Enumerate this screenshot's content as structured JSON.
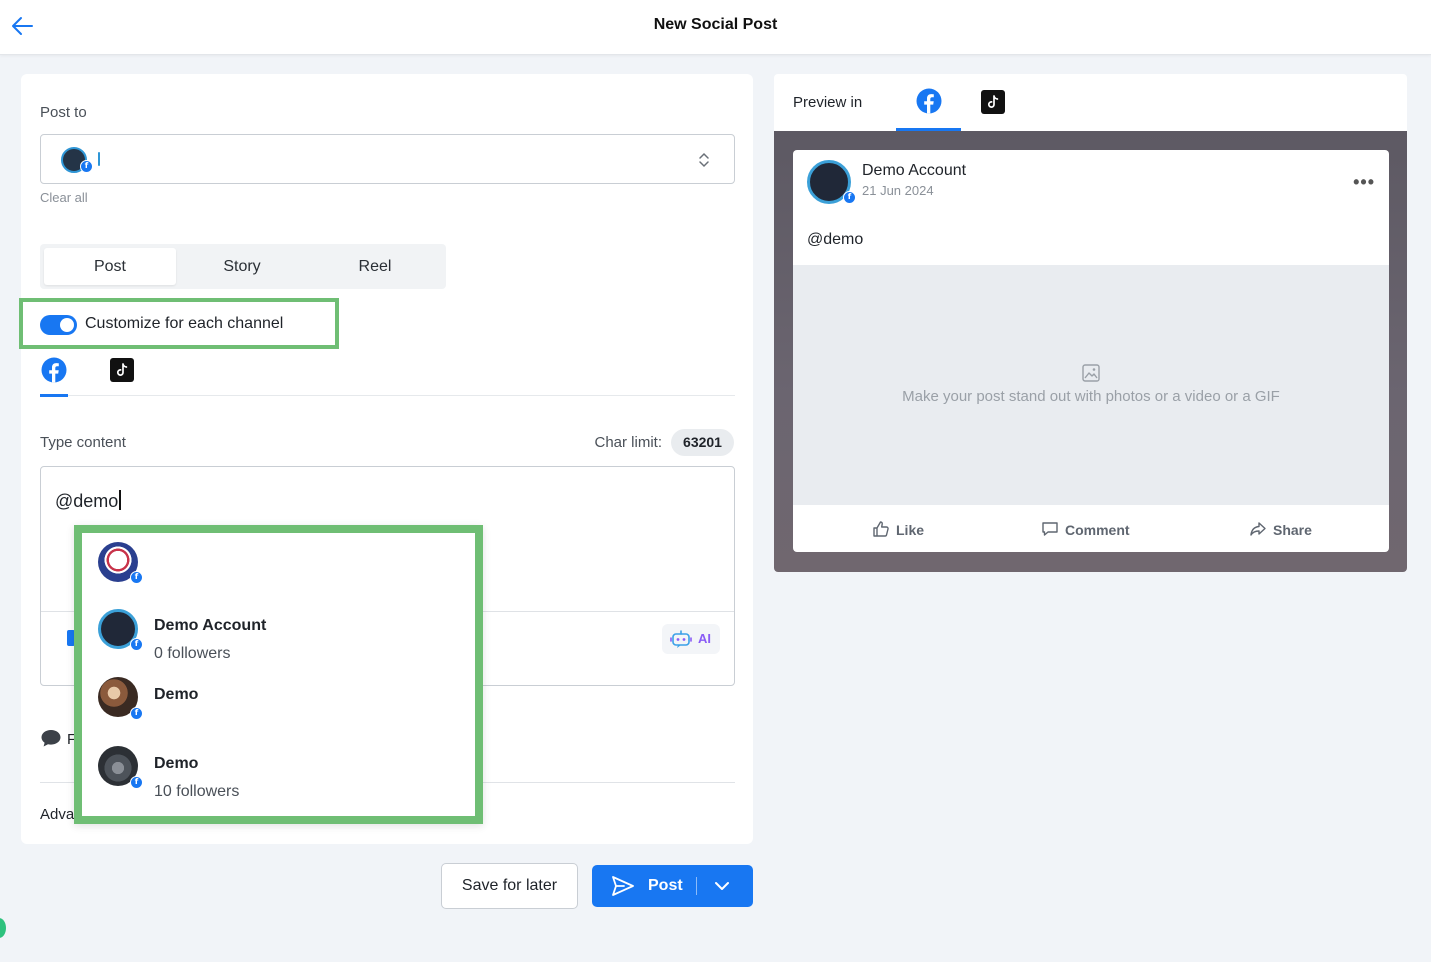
{
  "header": {
    "title": "New Social Post",
    "back_icon": "arrow-left-icon"
  },
  "composer": {
    "post_to_label": "Post to",
    "clear_all": "Clear all",
    "format_tabs": [
      {
        "label": "Post",
        "active": true
      },
      {
        "label": "Story",
        "active": false
      },
      {
        "label": "Reel",
        "active": false
      }
    ],
    "customize_label": "Customize for each channel",
    "customize_enabled": true,
    "channel_tabs": [
      "facebook-icon",
      "tiktok-icon"
    ],
    "type_content_label": "Type content",
    "char_limit_label": "Char limit:",
    "char_limit_value": "63201",
    "editor_value": "@demo",
    "ai_label": "AI",
    "comment_stub": "F",
    "advanced_stub": "Adva"
  },
  "mention_dropdown": {
    "items": [
      {
        "name": "",
        "sub": ""
      },
      {
        "name": "Demo Account",
        "sub": "0 followers"
      },
      {
        "name": "Demo",
        "sub": ""
      },
      {
        "name": "Demo",
        "sub": "10 followers"
      }
    ]
  },
  "actions": {
    "save_label": "Save for later",
    "post_label": "Post"
  },
  "preview": {
    "label": "Preview in",
    "account_name": "Demo Account",
    "date": "21 Jun 2024",
    "more": "•••",
    "text": "@demo",
    "media_placeholder": "Make your post stand out with photos or a video or a GIF",
    "like": "Like",
    "comment": "Comment",
    "share": "Share"
  },
  "colors": {
    "brand": "#1877f2",
    "highlight": "#6fbe74",
    "tiktok": "#111111"
  }
}
